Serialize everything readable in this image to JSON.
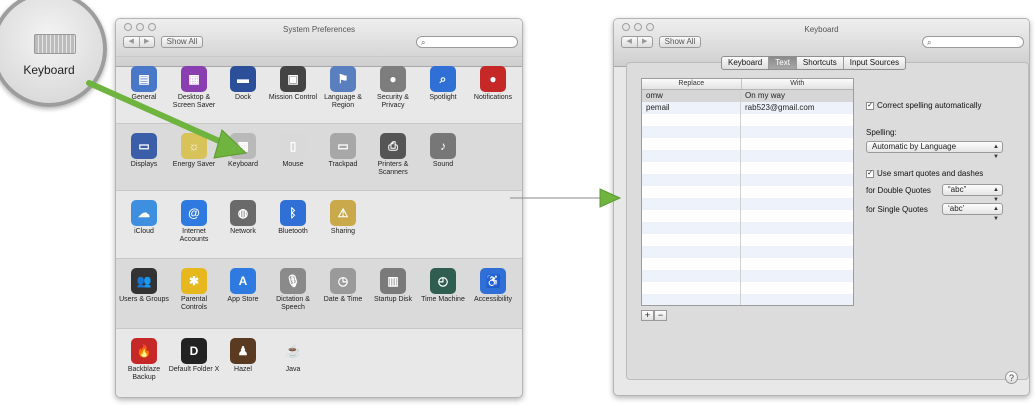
{
  "callout": {
    "label": "Keyboard"
  },
  "sysprefs": {
    "title": "System Preferences",
    "show_all": "Show All",
    "rows": [
      [
        {
          "label": "General",
          "color": "#4a78c8",
          "glyph": "▤"
        },
        {
          "label": "Desktop & Screen Saver",
          "color": "#8a3fb0",
          "glyph": "▦"
        },
        {
          "label": "Dock",
          "color": "#2c4f9a",
          "glyph": "▬"
        },
        {
          "label": "Mission Control",
          "color": "#444444",
          "glyph": "▣"
        },
        {
          "label": "Language & Region",
          "color": "#5a7fbf",
          "glyph": "⚑"
        },
        {
          "label": "Security & Privacy",
          "color": "#7d7d7d",
          "glyph": "●"
        },
        {
          "label": "Spotlight",
          "color": "#2f6fd6",
          "glyph": "⌕"
        },
        {
          "label": "Notifications",
          "color": "#c62828",
          "glyph": "●"
        }
      ],
      [
        {
          "label": "Displays",
          "color": "#3a5fa8",
          "glyph": "▭"
        },
        {
          "label": "Energy Saver",
          "color": "#d8c25a",
          "glyph": "☼"
        },
        {
          "label": "Keyboard",
          "color": "#b9b9b9",
          "glyph": "▦"
        },
        {
          "label": "Mouse",
          "color": "#d9d9d9",
          "glyph": "▯"
        },
        {
          "label": "Trackpad",
          "color": "#a7a7a7",
          "glyph": "▭"
        },
        {
          "label": "Printers & Scanners",
          "color": "#555555",
          "glyph": "⎙"
        },
        {
          "label": "Sound",
          "color": "#777777",
          "glyph": "♪"
        }
      ],
      [
        {
          "label": "iCloud",
          "color": "#3f8fe0",
          "glyph": "☁"
        },
        {
          "label": "Internet Accounts",
          "color": "#2f7ae0",
          "glyph": "@"
        },
        {
          "label": "Network",
          "color": "#6a6a6a",
          "glyph": "◍"
        },
        {
          "label": "Bluetooth",
          "color": "#2f6fd6",
          "glyph": "ᛒ"
        },
        {
          "label": "Sharing",
          "color": "#c9a94a",
          "glyph": "⚠"
        }
      ],
      [
        {
          "label": "Users & Groups",
          "color": "#333333",
          "glyph": "👥"
        },
        {
          "label": "Parental Controls",
          "color": "#e6b81e",
          "glyph": "✱"
        },
        {
          "label": "App Store",
          "color": "#2f7ae0",
          "glyph": "A"
        },
        {
          "label": "Dictation & Speech",
          "color": "#8a8a8a",
          "glyph": "🎙"
        },
        {
          "label": "Date & Time",
          "color": "#9a9a9a",
          "glyph": "◷"
        },
        {
          "label": "Startup Disk",
          "color": "#7a7a7a",
          "glyph": "▥"
        },
        {
          "label": "Time Machine",
          "color": "#2f5d4f",
          "glyph": "◴"
        },
        {
          "label": "Accessibility",
          "color": "#2f6fd6",
          "glyph": "♿"
        }
      ],
      [
        {
          "label": "Backblaze Backup",
          "color": "#c62828",
          "glyph": "🔥"
        },
        {
          "label": "Default Folder X",
          "color": "#222222",
          "glyph": "D"
        },
        {
          "label": "Hazel",
          "color": "#5a3a20",
          "glyph": "♟"
        },
        {
          "label": "Java",
          "color": "#e8e8e8",
          "glyph": "☕"
        }
      ]
    ]
  },
  "keyboard": {
    "title": "Keyboard",
    "show_all": "Show All",
    "tabs": [
      {
        "label": "Keyboard",
        "selected": false
      },
      {
        "label": "Text",
        "selected": true
      },
      {
        "label": "Shortcuts",
        "selected": false
      },
      {
        "label": "Input Sources",
        "selected": false
      }
    ],
    "table": {
      "headers": [
        "Replace",
        "With"
      ],
      "rows": [
        [
          "omw",
          "On my way"
        ],
        [
          "pemail",
          "rab523@gmail.com"
        ]
      ]
    },
    "add_label": "+",
    "remove_label": "−",
    "correct_spelling": {
      "label": "Correct spelling automatically",
      "checked": true
    },
    "spelling_label": "Spelling:",
    "spelling_value": "Automatic by Language",
    "smart_quotes": {
      "label": "Use smart quotes and dashes",
      "checked": true
    },
    "double_quotes_label": "for Double Quotes",
    "double_quotes_value": "“abc”",
    "single_quotes_label": "for Single Quotes",
    "single_quotes_value": "‘abc’",
    "help_label": "?"
  },
  "colors": {
    "arrow": "#6fb43f"
  }
}
